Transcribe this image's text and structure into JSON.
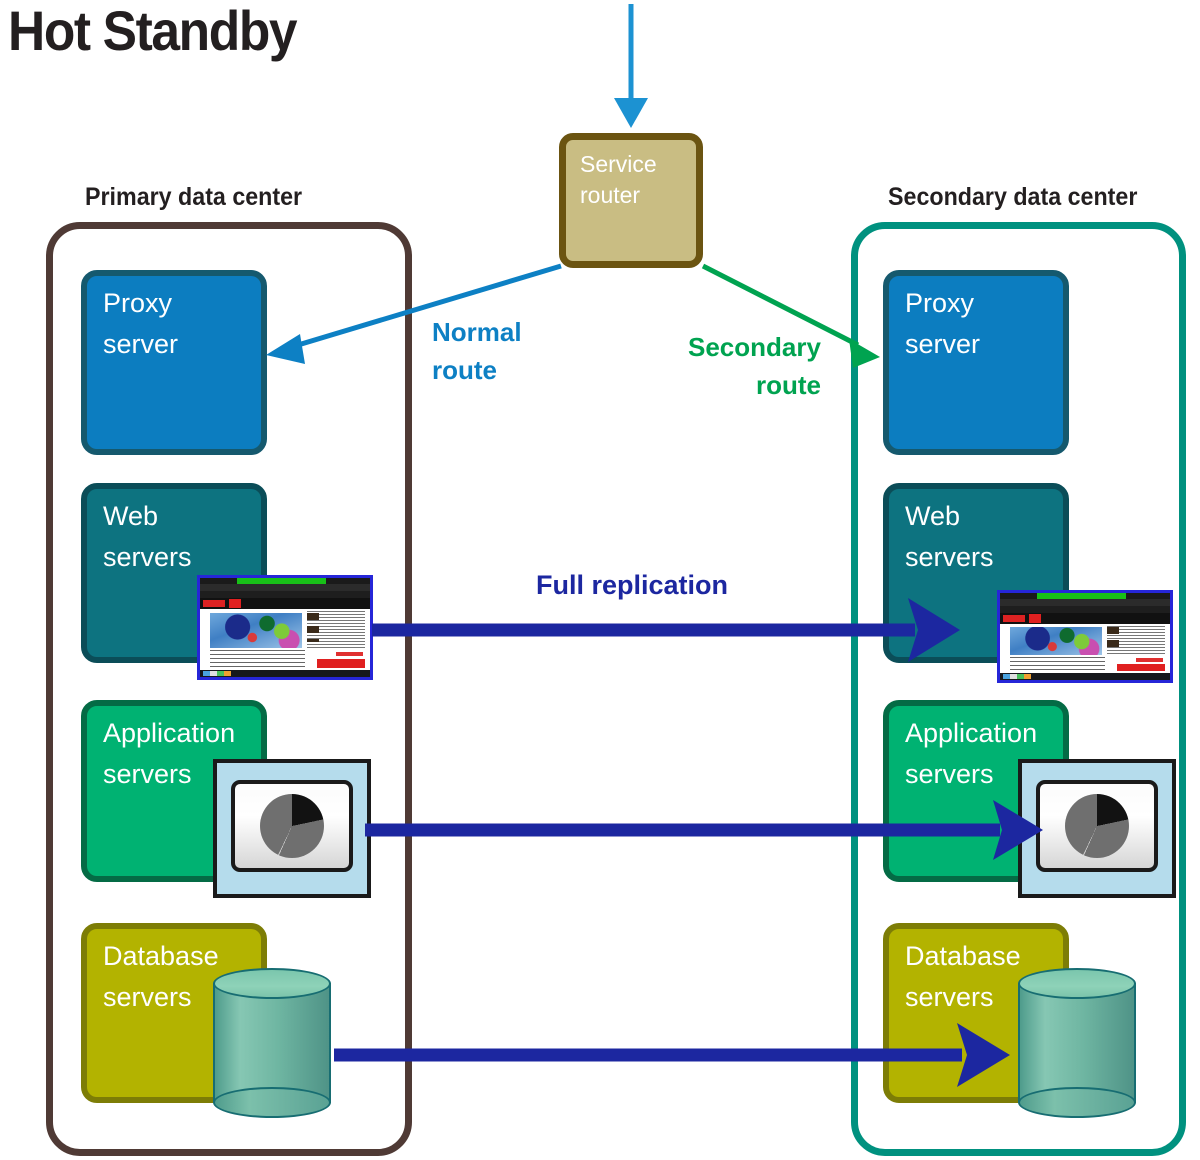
{
  "title": "Hot Standby",
  "service_router": {
    "label": "Service\nrouter",
    "fill": "#c9bd83",
    "border": "#6b5411"
  },
  "routes": {
    "inbound_arrow": "inbound-traffic-arrow",
    "normal": {
      "label": "Normal\nroute",
      "color": "#0d80c4"
    },
    "secondary": {
      "label": "Secondary\nroute",
      "color": "#00a350"
    },
    "replication": {
      "label": "Full replication",
      "color": "#1c27a0"
    }
  },
  "data_centers": [
    {
      "id": "primary",
      "heading": "Primary data center",
      "border_color": "#4f3a35",
      "tiers": [
        {
          "id": "proxy",
          "label": "Proxy\nserver",
          "fill": "#0c7dc0",
          "border": "#15596e",
          "icon": "none"
        },
        {
          "id": "web",
          "label": "Web\nservers",
          "fill": "#0d7380",
          "border": "#0b4d58",
          "icon": "browser-window-icon"
        },
        {
          "id": "app",
          "label": "Application\nservers",
          "fill": "#00b272",
          "border": "#046b45",
          "icon": "pie-chart-monitor-icon"
        },
        {
          "id": "database",
          "label": "Database\nservers",
          "fill": "#b3b300",
          "border": "#7d7d06",
          "icon": "database-cylinder-icon"
        }
      ]
    },
    {
      "id": "secondary",
      "heading": "Secondary data center",
      "border_color": "#00917f",
      "tiers": [
        {
          "id": "proxy",
          "label": "Proxy\nserver",
          "fill": "#0c7dc0",
          "border": "#15596e",
          "icon": "none"
        },
        {
          "id": "web",
          "label": "Web\nservers",
          "fill": "#0d7380",
          "border": "#0b4d58",
          "icon": "browser-window-icon"
        },
        {
          "id": "app",
          "label": "Application\nservers",
          "fill": "#00b272",
          "border": "#046b45",
          "icon": "pie-chart-monitor-icon"
        },
        {
          "id": "database",
          "label": "Database\nservers",
          "fill": "#b3b300",
          "border": "#7d7d06",
          "icon": "database-cylinder-icon"
        }
      ]
    }
  ]
}
